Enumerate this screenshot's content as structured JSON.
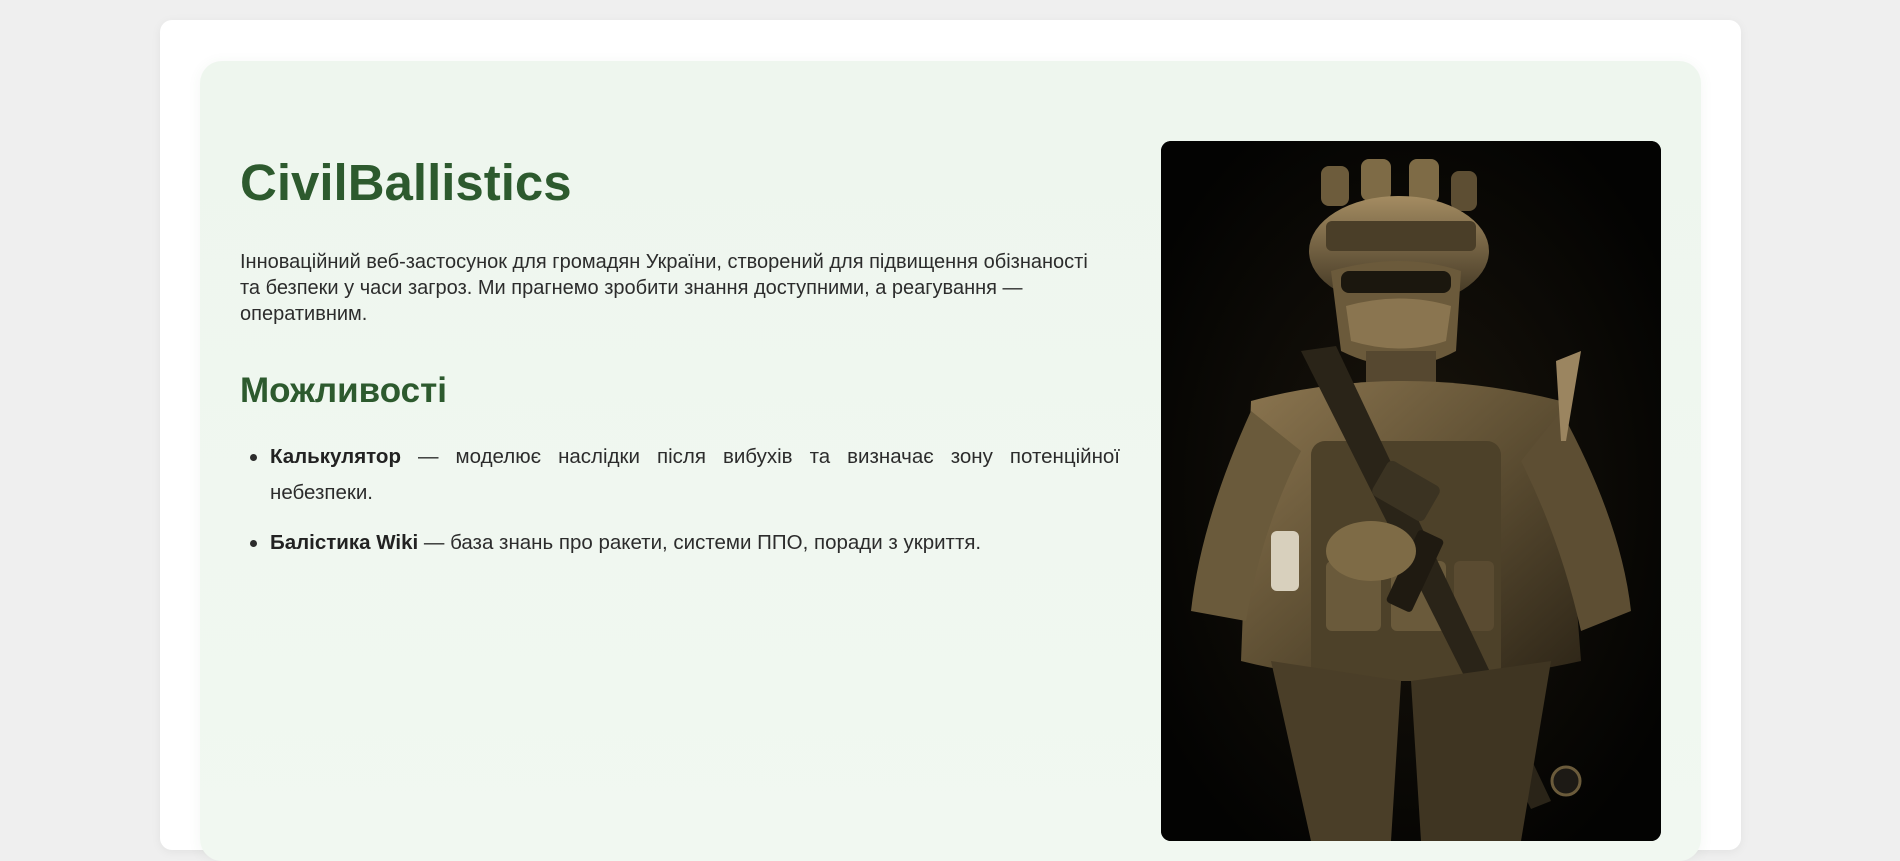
{
  "hero": {
    "title": "CivilBallistics",
    "description": "Інноваційний веб-застосунок для громадян України, створений для підвищення обізнаності та безпеки у часи загроз. Ми прагнемо зробити знання доступними, а реагування — оперативним.",
    "features_heading": "Можливості",
    "features": [
      {
        "name": "Калькулятор",
        "text": " — моделює наслідки після вибухів та визначає зону потенційної небезпеки."
      },
      {
        "name": "Балістика Wiki",
        "text": " — база знань про ракети, системи ППО, поради з укриття."
      }
    ],
    "image_icon": "soldier-photo"
  },
  "colors": {
    "background": "#efefef",
    "card": "#ffffff",
    "hero_bg": "#eef6ee",
    "heading": "#2d5a2e",
    "text": "#2c2c2c"
  }
}
